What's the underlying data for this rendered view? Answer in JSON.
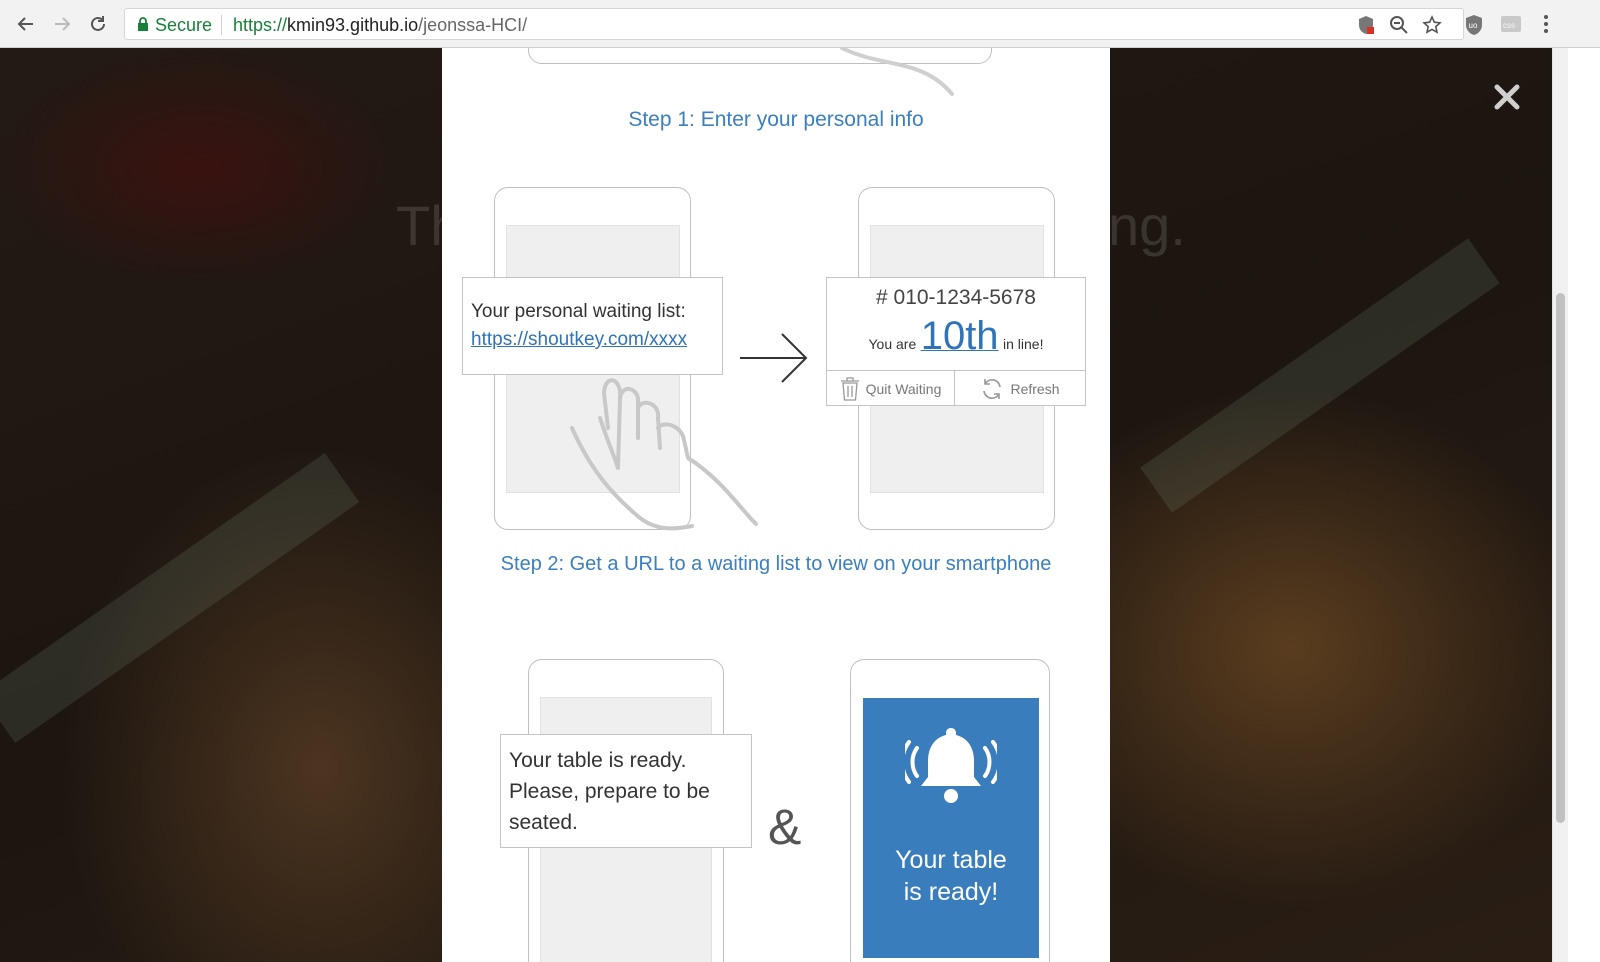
{
  "browser": {
    "secure_label": "Secure",
    "url_scheme": "https://",
    "url_host": "kmin93.github.io",
    "url_path": "/jeonssa-HCI/",
    "icons": [
      "back-icon",
      "forward-icon",
      "reload-icon",
      "lock-icon",
      "shield-icon",
      "zoom-icon",
      "star-icon",
      "ublock-icon",
      "css-icon",
      "menu-icon"
    ]
  },
  "background": {
    "heading_left": "Th",
    "heading_right": "ng."
  },
  "modal": {
    "step1_title": "Step 1: Enter your personal info",
    "step2_title": "Step 2: Get a URL to a waiting list to view on your smartphone",
    "waiting_card": {
      "label": "Your personal waiting list:",
      "link": "https://shoutkey.com/xxxx"
    },
    "status_card": {
      "phone": "# 010-1234-5678",
      "you_are": "You are",
      "position": "10th",
      "in_line": "in line!",
      "quit_label": "Quit Waiting",
      "refresh_label": "Refresh"
    },
    "ready_card": {
      "line1": "Your table is ready.",
      "line2": "Please, prepare to be",
      "line3": "seated."
    },
    "ampersand": "&",
    "notification": {
      "line1": "Your table",
      "line2": "is ready!"
    }
  },
  "colors": {
    "accent": "#3a7fbf",
    "secure": "#188038",
    "notification_bg": "#3a7dbd"
  }
}
